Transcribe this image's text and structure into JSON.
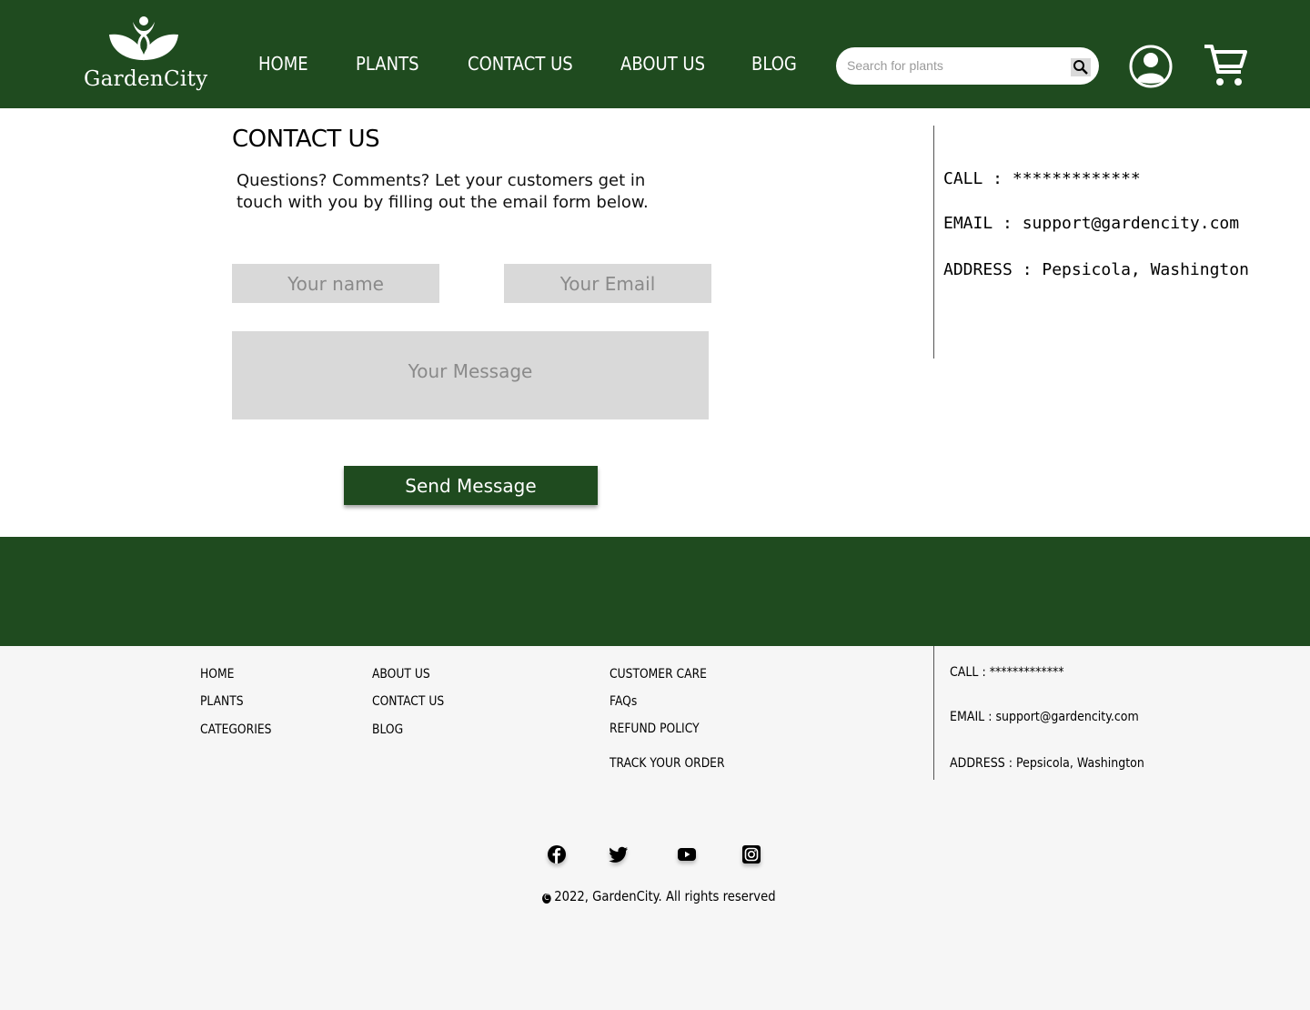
{
  "brand": {
    "name": "GardenCity",
    "color": "#1f4b1f",
    "logo_icon": "leaf-figure-logo-icon"
  },
  "nav": [
    {
      "label": "HOME"
    },
    {
      "label": "PLANTS"
    },
    {
      "label": "CONTACT US"
    },
    {
      "label": "ABOUT US"
    },
    {
      "label": "BLOG"
    }
  ],
  "search": {
    "placeholder": "Search for plants",
    "icon": "search-icon"
  },
  "header_icons": {
    "account": "user-icon",
    "cart": "cart-icon"
  },
  "contact": {
    "title": "CONTACT US",
    "intro_line1": "Questions? Comments? Let your customers get in",
    "intro_line2": "touch with you by filling out the email form below.",
    "form": {
      "name_placeholder": "Your name",
      "email_placeholder": "Your Email",
      "message_placeholder": "Your Message",
      "submit_label": "Send Message"
    },
    "info": {
      "call": "CALL : *************",
      "email": "EMAIL : support@gardencity.com",
      "address": "ADDRESS : Pepsicola, Washington"
    }
  },
  "footer": {
    "col1": [
      "HOME",
      "PLANTS",
      "CATEGORIES"
    ],
    "col2": [
      "ABOUT US",
      "CONTACT US",
      "BLOG"
    ],
    "col3": [
      "CUSTOMER CARE",
      "FAQs",
      "REFUND POLICY",
      "TRACK YOUR ORDER"
    ],
    "info": {
      "call": "CALL : *************",
      "email": "EMAIL : support@gardencity.com",
      "address": "ADDRESS : Pepsicola, Washington"
    },
    "social": [
      "facebook-icon",
      "twitter-icon",
      "youtube-icon",
      "instagram-icon"
    ],
    "copyright_symbol": "C",
    "copyright": "2022, GardenCity. All rights reserved"
  }
}
